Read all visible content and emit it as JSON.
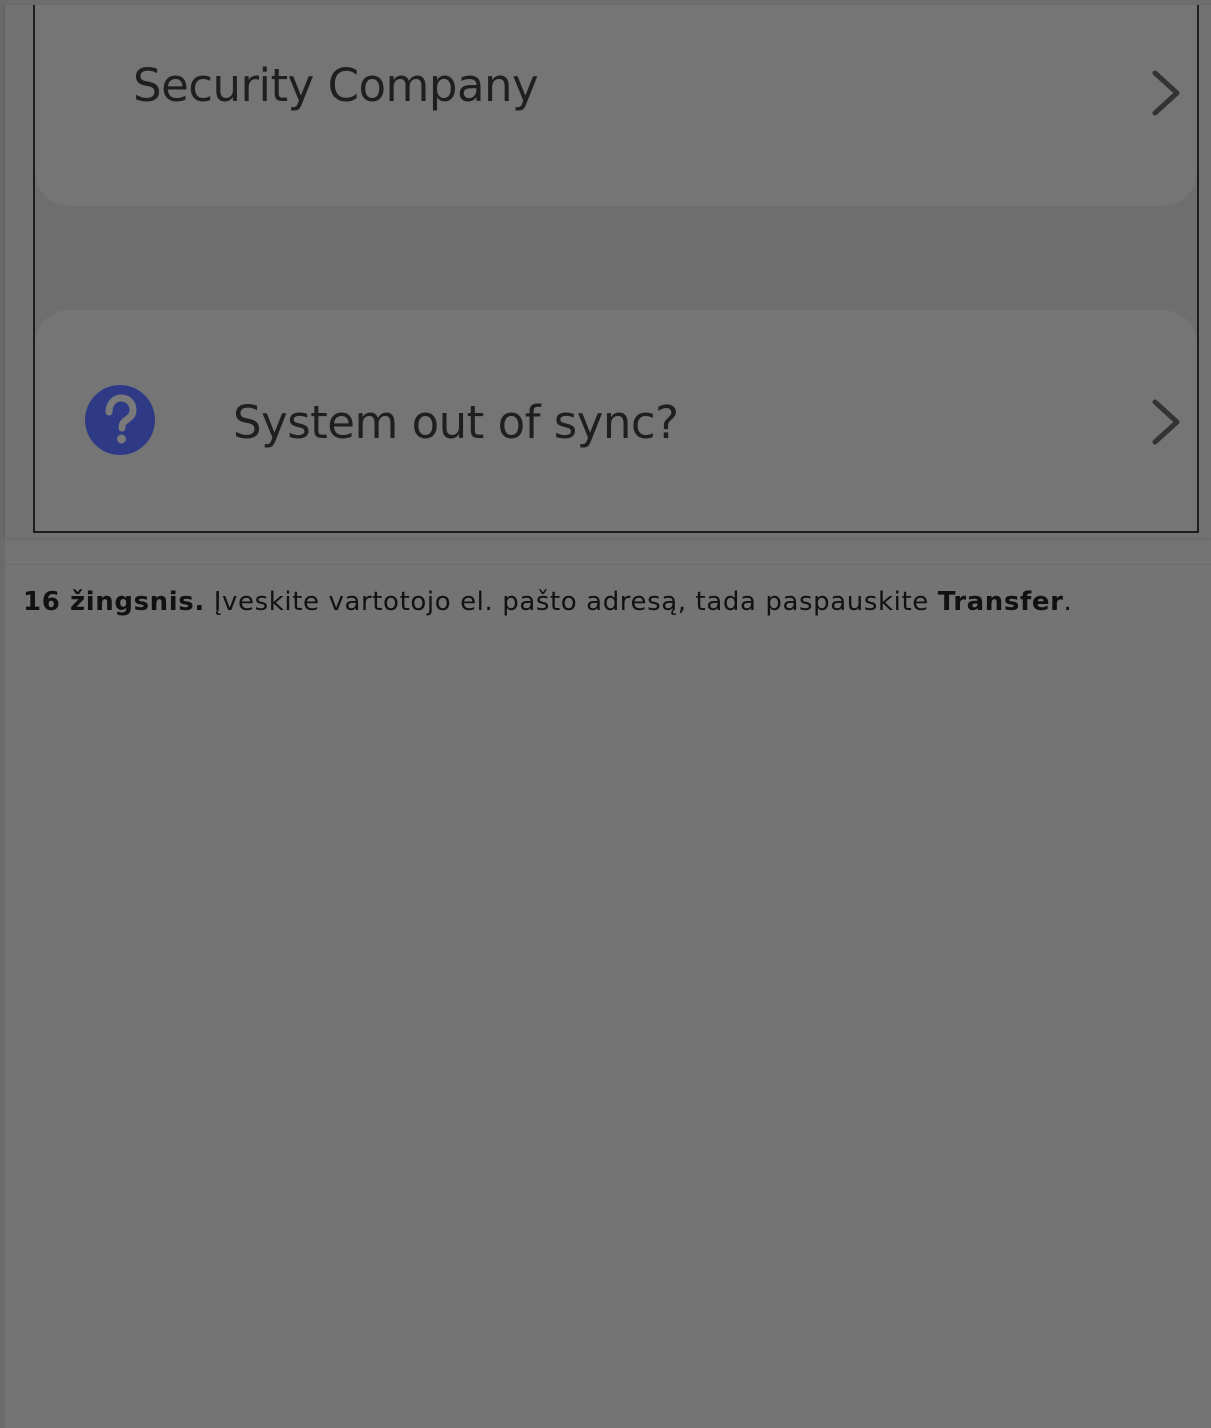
{
  "screenshot": {
    "security_company_label": "Security Company",
    "system_sync_label": "System out of sync?",
    "icons": {
      "chevron": "chevron-right-icon",
      "help": "question-circle-icon"
    },
    "colors": {
      "help_icon": "#2e3a86",
      "chevron": "#333333"
    }
  },
  "instruction": {
    "step_label": "16 žingsnis.",
    "body_text": " Įveskite vartotojo el. pašto adresą, tada paspauskite ",
    "action_label": "Transfer",
    "end_punct": "."
  }
}
